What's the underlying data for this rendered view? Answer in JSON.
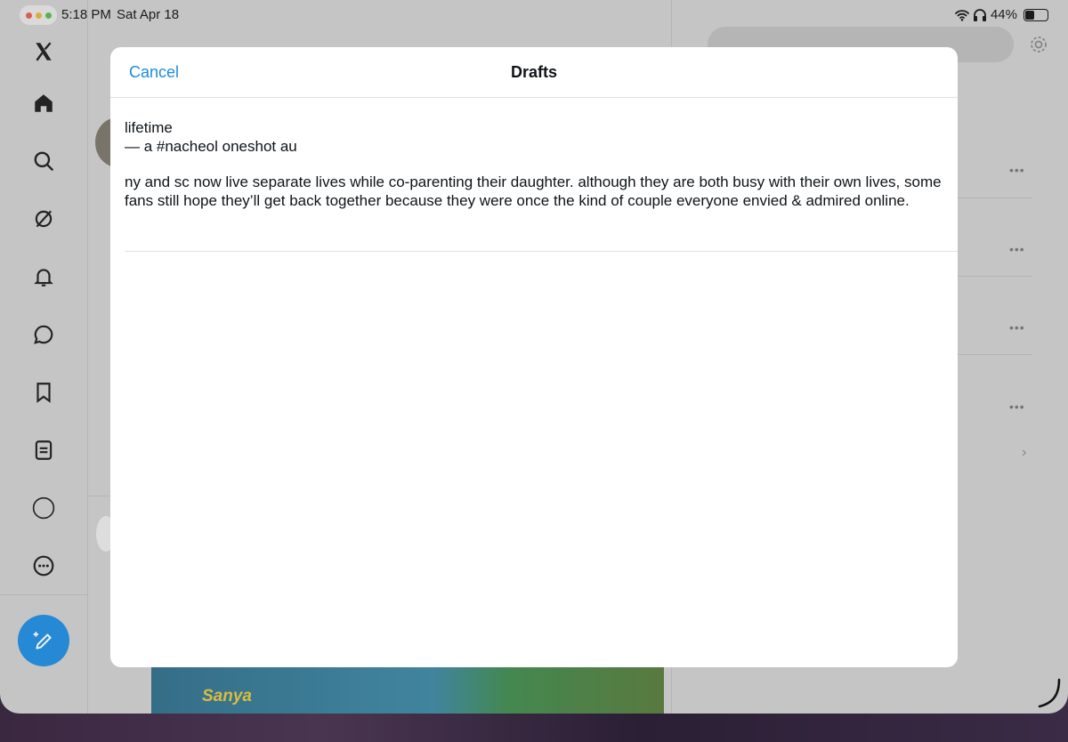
{
  "status_bar": {
    "time": "5:18 PM",
    "date": "Sat Apr 18",
    "battery": "44%",
    "icons": [
      "wifi-icon",
      "headphones-icon",
      "battery-icon"
    ]
  },
  "sidebar": {
    "icons": [
      "x-logo-icon",
      "home-icon",
      "search-icon",
      "grok-icon",
      "bell-icon",
      "message-icon",
      "bookmark-icon",
      "list-icon",
      "profile-circle-icon",
      "more-icon"
    ],
    "compose_icon": "compose-icon"
  },
  "background_feed": {
    "image_brand": "Sanya"
  },
  "modal": {
    "cancel_label": "Cancel",
    "title": "Drafts",
    "draft": {
      "line1": "lifetime",
      "line2": "— a #nacheol oneshot au",
      "body": "ny and sc now live separate lives while co-parenting their daughter. although they are both busy with their own lives, some fans still hope they’ll get back together because they were once the kind of couple everyone envied & admired online."
    }
  },
  "colors": {
    "accent": "#1d8ce0",
    "text": "#0f1419",
    "divider": "#e2e2e2"
  }
}
